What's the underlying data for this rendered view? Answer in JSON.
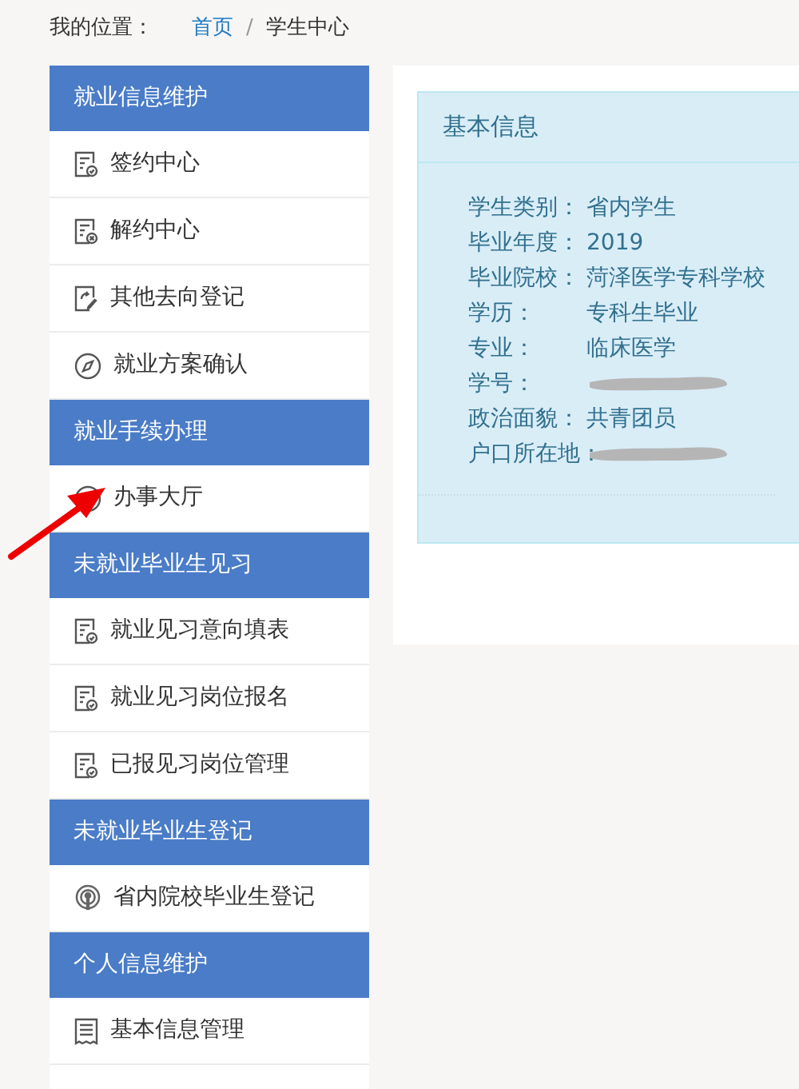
{
  "breadcrumb": {
    "label": "我的位置：",
    "links": [
      "首页",
      "学生中心"
    ],
    "separator": "/"
  },
  "sidebar": {
    "groups": [
      {
        "title": "就业信息维护",
        "items": [
          {
            "label": "签约中心",
            "kind": "doc-check"
          },
          {
            "label": "解约中心",
            "kind": "doc-cross"
          },
          {
            "label": "其他去向登记",
            "kind": "doc-edit"
          },
          {
            "label": "就业方案确认",
            "kind": "compass"
          }
        ]
      },
      {
        "title": "就业手续办理",
        "items": [
          {
            "label": "办事大厅",
            "kind": "compass"
          }
        ]
      },
      {
        "title": "未就业毕业生见习",
        "items": [
          {
            "label": "就业见习意向填表",
            "kind": "doc-check"
          },
          {
            "label": "就业见习岗位报名",
            "kind": "doc-check"
          },
          {
            "label": "已报见习岗位管理",
            "kind": "doc-check"
          }
        ]
      },
      {
        "title": "未就业毕业生登记",
        "items": [
          {
            "label": "省内院校毕业生登记",
            "kind": "broadcast"
          }
        ]
      },
      {
        "title": "个人信息维护",
        "items": [
          {
            "label": "基本信息管理",
            "kind": "receipt"
          }
        ]
      }
    ]
  },
  "panel": {
    "title": "基本信息",
    "fields": [
      {
        "label": "学生类别：",
        "value": "省内学生",
        "redacted": false
      },
      {
        "label": "毕业年度：",
        "value": "2019",
        "redacted": false
      },
      {
        "label": "毕业院校：",
        "value": "菏泽医学专科学校",
        "redacted": false
      },
      {
        "label": "学历：",
        "value": "专科生毕业",
        "redacted": false
      },
      {
        "label": "专业：",
        "value": "临床医学",
        "redacted": false
      },
      {
        "label": "学号：",
        "redacted": true
      },
      {
        "label": "政治面貌：",
        "value": "共青团员",
        "redacted": false
      },
      {
        "label": "户口所在地：",
        "redacted": true
      }
    ]
  }
}
